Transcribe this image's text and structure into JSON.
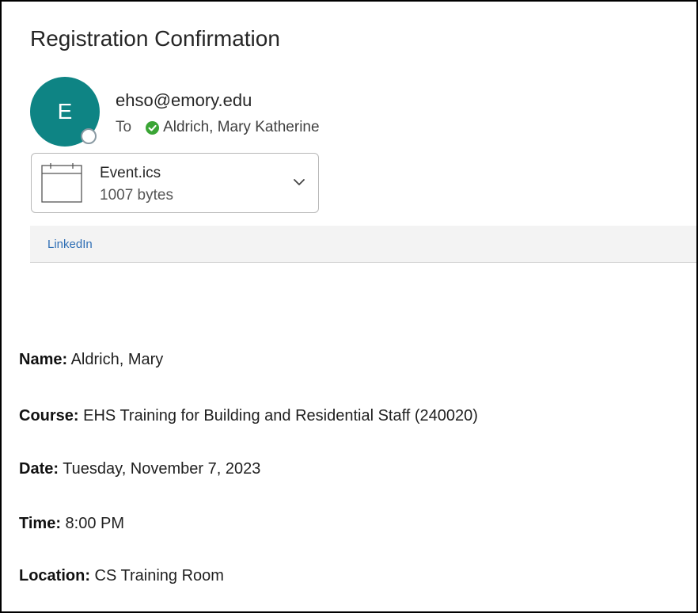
{
  "email": {
    "subject": "Registration Confirmation",
    "avatar_initial": "E",
    "sender": "ehso@emory.edu",
    "to_label": "To",
    "recipient": "Aldrich, Mary Katherine"
  },
  "attachment": {
    "name": "Event.ics",
    "size": "1007 bytes",
    "icon": "calendar-icon"
  },
  "addins": {
    "link_label": "LinkedIn"
  },
  "body": {
    "fields": [
      {
        "label": "Name:",
        "value": " Aldrich, Mary"
      },
      {
        "label": "Course:",
        "value": " EHS Training for Building and Residential Staff (240020)"
      },
      {
        "label": "Date:",
        "value": " Tuesday, November 7, 2023"
      },
      {
        "label": "Time:",
        "value": " 8:00 PM"
      },
      {
        "label": "Location:",
        "value": " CS Training Room"
      }
    ]
  },
  "colors": {
    "avatar_bg": "#0e8484",
    "check_green": "#3aa535",
    "link_blue": "#2f6fb5"
  }
}
